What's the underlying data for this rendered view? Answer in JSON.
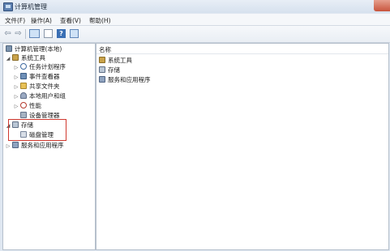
{
  "window": {
    "title": "计算机管理"
  },
  "menu": [
    "文件(F)",
    "操作(A)",
    "查看(V)",
    "帮助(H)"
  ],
  "toolbar": {
    "help_label": "?"
  },
  "tree": {
    "root": "计算机管理(本地)",
    "system_tools": "系统工具",
    "children": [
      "任务计划程序",
      "事件查看器",
      "共享文件夹",
      "本地用户和组",
      "性能",
      "设备管理器"
    ],
    "storage": "存储",
    "disk_management": "磁盘管理",
    "services": "服务和应用程序"
  },
  "list": {
    "column_name": "名称",
    "items": [
      "系统工具",
      "存储",
      "服务和应用程序"
    ]
  },
  "colors": {
    "highlight": "#d0392f"
  }
}
